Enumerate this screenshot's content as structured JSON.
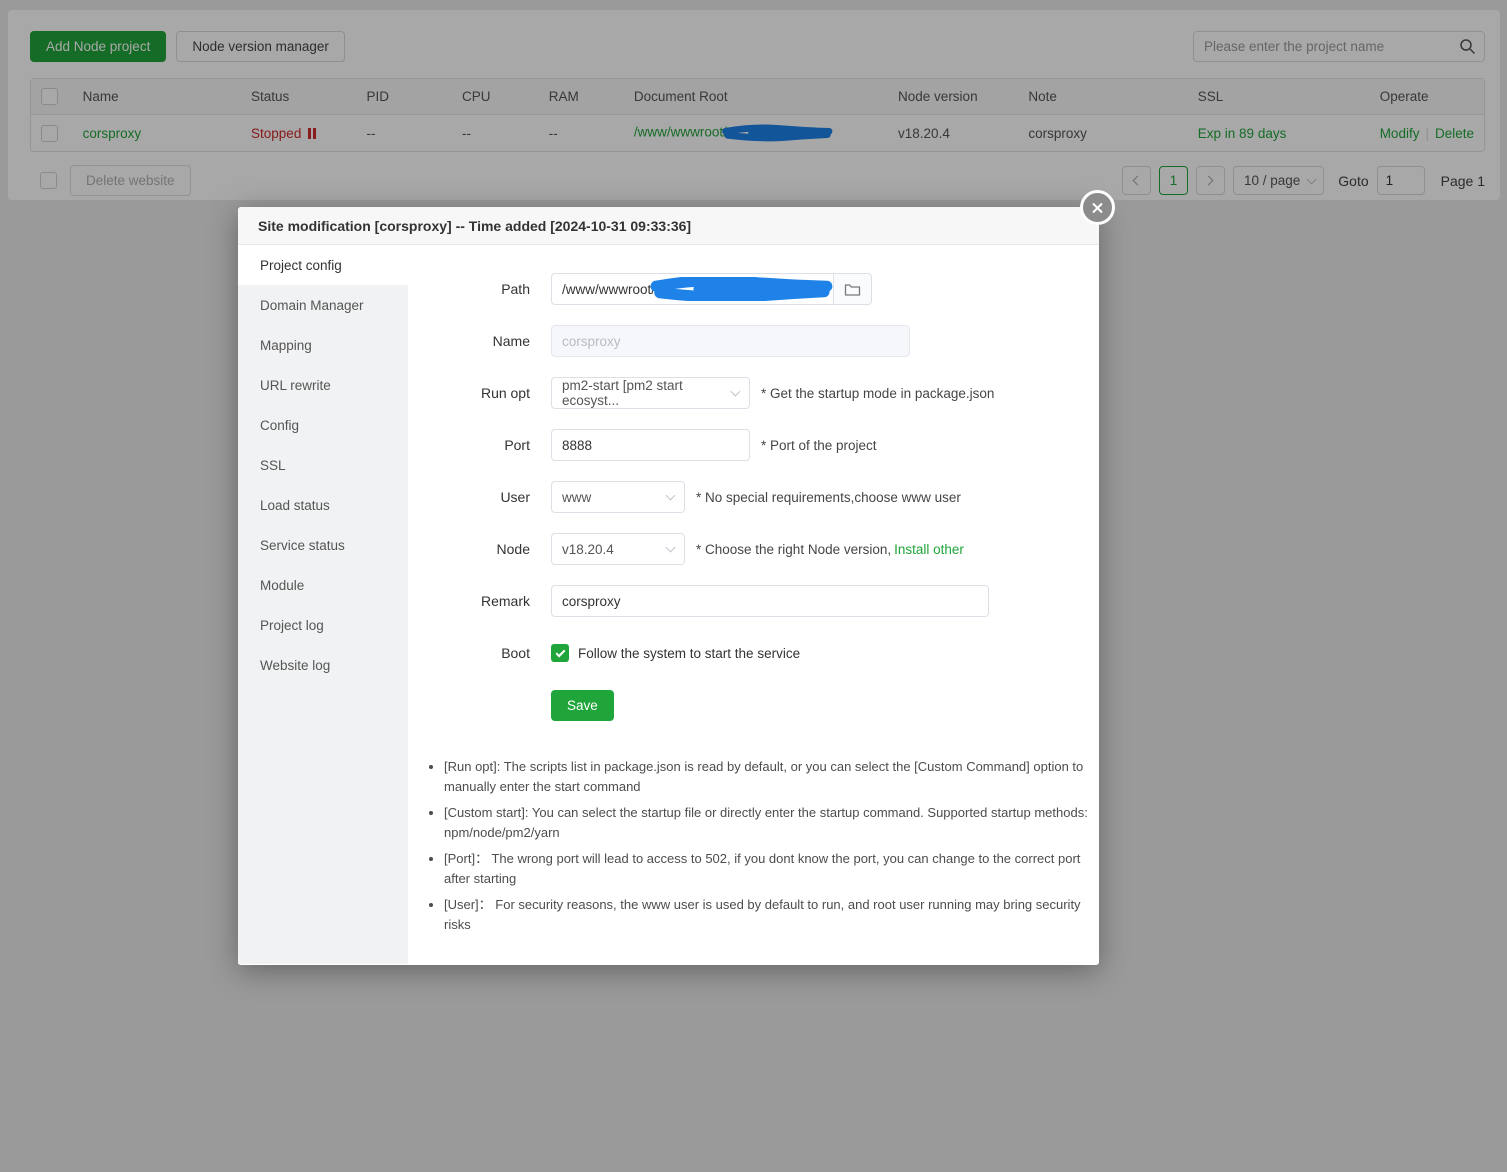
{
  "page": {
    "toolbar": {
      "add_button": "Add Node project",
      "version_button": "Node version manager",
      "search_placeholder": "Please enter the project name"
    },
    "table": {
      "headers": [
        "Name",
        "Status",
        "PID",
        "CPU",
        "RAM",
        "Document Root",
        "Node version",
        "Note",
        "SSL",
        "Operate"
      ],
      "row": {
        "name": "corsproxy",
        "status": "Stopped",
        "pid": "--",
        "cpu": "--",
        "ram": "--",
        "doc_root": "/www/wwwroot/",
        "node_version": "v18.20.4",
        "note": "corsproxy",
        "ssl": "Exp in 89 days",
        "modify": "Modify",
        "delete": "Delete"
      }
    },
    "footer": {
      "delete_button": "Delete website",
      "page_current": "1",
      "page_size": "10 / page",
      "goto_label": "Goto",
      "goto_value": "1",
      "page_info": "Page 1"
    }
  },
  "modal": {
    "title": "Site modification [corsproxy] -- Time added [2024-10-31 09:33:36]",
    "tabs": [
      "Project config",
      "Domain Manager",
      "Mapping",
      "URL rewrite",
      "Config",
      "SSL",
      "Load status",
      "Service status",
      "Module",
      "Project log",
      "Website log"
    ],
    "form": {
      "path": {
        "label": "Path",
        "value": "/www/wwwroot/"
      },
      "name": {
        "label": "Name",
        "value": "corsproxy"
      },
      "run_opt": {
        "label": "Run opt",
        "value": "pm2-start [pm2 start ecosyst...",
        "hint": "* Get the startup mode in package.json"
      },
      "port": {
        "label": "Port",
        "value": "8888",
        "hint": "* Port of the project"
      },
      "user": {
        "label": "User",
        "value": "www",
        "hint": "* No special requirements,choose www user"
      },
      "node": {
        "label": "Node",
        "value": "v18.20.4",
        "hint": "* Choose the right Node version,",
        "hint_link": "Install other"
      },
      "remark": {
        "label": "Remark",
        "value": "corsproxy"
      },
      "boot": {
        "label": "Boot",
        "text": "Follow the system to start the service"
      },
      "save_label": "Save"
    },
    "notes": [
      "[Run opt]: The scripts list in package.json is read by default, or you can select the [Custom Command] option to manually enter the start command",
      "[Custom start]: You can select the startup file or directly enter the startup command. Supported startup methods: npm/node/pm2/yarn",
      "[Port]：  The wrong port will lead to access to 502, if you dont know the port, you can change to the correct port after starting",
      "[User]：  For security reasons, the www user is used by default to run, and root user running may bring security risks"
    ]
  },
  "colors": {
    "accent_green": "#20a53a",
    "status_red": "#cf2a2a",
    "scribble_blue": "#1e82e8"
  }
}
